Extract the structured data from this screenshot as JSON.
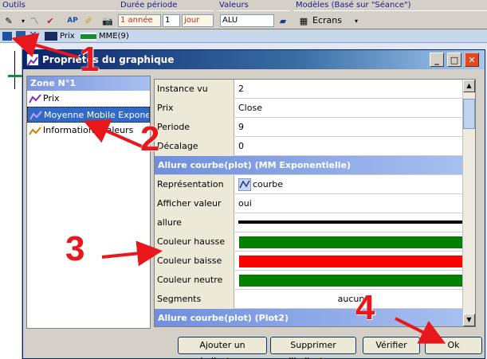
{
  "toolbar_labels": {
    "outils": "Outils",
    "duree": "Durée  période",
    "valeurs": "Valeurs",
    "modeles": "Modèles (Basé sur \"Séance\")"
  },
  "toolbar_fields": {
    "periode": "1 année",
    "count": "1",
    "unit": "jour",
    "valeur": "ALU",
    "ecrans": "Ecrans"
  },
  "second_row": {
    "prix": "Prix",
    "mme": "MME(9)"
  },
  "dialog": {
    "title": "Propriétés du graphique",
    "zone_header": "Zone N°1",
    "tree": [
      {
        "label": "Prix"
      },
      {
        "label": "Moyenne Mobile Exponent..."
      },
      {
        "label": "Informations Valeurs"
      }
    ]
  },
  "grid": {
    "rows": [
      {
        "type": "prop",
        "label": "Instance vu",
        "value": "2"
      },
      {
        "type": "prop",
        "label": "Prix",
        "value": "Close"
      },
      {
        "type": "prop",
        "label": "Periode",
        "value": "9"
      },
      {
        "type": "prop",
        "label": "Décalage",
        "value": "0"
      },
      {
        "type": "section",
        "label": "Allure courbe(plot)  (MM Exponentielle)"
      },
      {
        "type": "prop",
        "label": "Représentation",
        "value": "courbe"
      },
      {
        "type": "prop",
        "label": "Afficher valeur",
        "value": "oui"
      },
      {
        "type": "prop",
        "label": "allure",
        "value": ""
      },
      {
        "type": "prop",
        "label": "Couleur hausse",
        "value": ""
      },
      {
        "type": "prop",
        "label": "Couleur baisse",
        "value": ""
      },
      {
        "type": "prop",
        "label": "Couleur neutre",
        "value": ""
      },
      {
        "type": "prop",
        "label": "Segments",
        "value": "aucun"
      },
      {
        "type": "section",
        "label": "Allure courbe(plot)  (Plot2)"
      }
    ],
    "colors": {
      "hausse": "#008000",
      "baisse": "#ff0000",
      "neutre": "#008000"
    }
  },
  "buttons": {
    "add": "Ajouter un indicateur",
    "remove": "Supprimer l'indicateur",
    "verify": "Vérifier",
    "ok": "Ok"
  },
  "annotations": {
    "one": "1",
    "two": "2",
    "three": "3",
    "four": "4"
  }
}
